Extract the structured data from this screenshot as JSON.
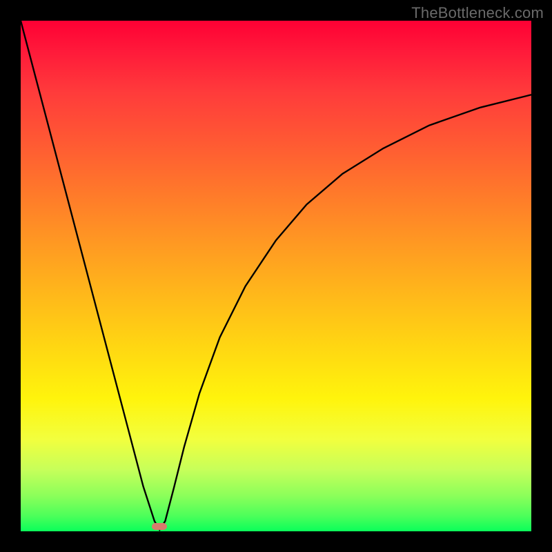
{
  "watermark": "TheBottleneck.com",
  "chart_data": {
    "type": "line",
    "title": "",
    "xlabel": "",
    "ylabel": "",
    "xlim": [
      0,
      1
    ],
    "ylim": [
      0,
      1
    ],
    "grid": false,
    "legend": false,
    "notes": "Background is a vertical red→yellow→green gradient. Curve is an absolute-value-style notch near x≈0.27 reaching y≈0; left branch rises steeply to top-left corner, right branch rises with decreasing slope toward upper right.",
    "series": [
      {
        "name": "curve",
        "x": [
          0.0,
          0.03,
          0.06,
          0.09,
          0.12,
          0.15,
          0.18,
          0.21,
          0.24,
          0.262,
          0.272,
          0.283,
          0.3,
          0.32,
          0.35,
          0.39,
          0.44,
          0.5,
          0.56,
          0.63,
          0.71,
          0.8,
          0.9,
          1.0
        ],
        "y": [
          1.0,
          0.886,
          0.772,
          0.658,
          0.544,
          0.43,
          0.316,
          0.202,
          0.088,
          0.02,
          0.003,
          0.02,
          0.085,
          0.165,
          0.27,
          0.38,
          0.48,
          0.57,
          0.64,
          0.7,
          0.75,
          0.795,
          0.83,
          0.855
        ]
      }
    ],
    "marker": {
      "x": 0.272,
      "y": 0.01,
      "shape": "rounded-rect",
      "color": "#d77b6c"
    }
  },
  "colors": {
    "curve_stroke": "#000000",
    "background_top": "#ff0034",
    "background_bottom": "#0aff5a",
    "frame": "#000000",
    "watermark": "#6a6a6a"
  }
}
